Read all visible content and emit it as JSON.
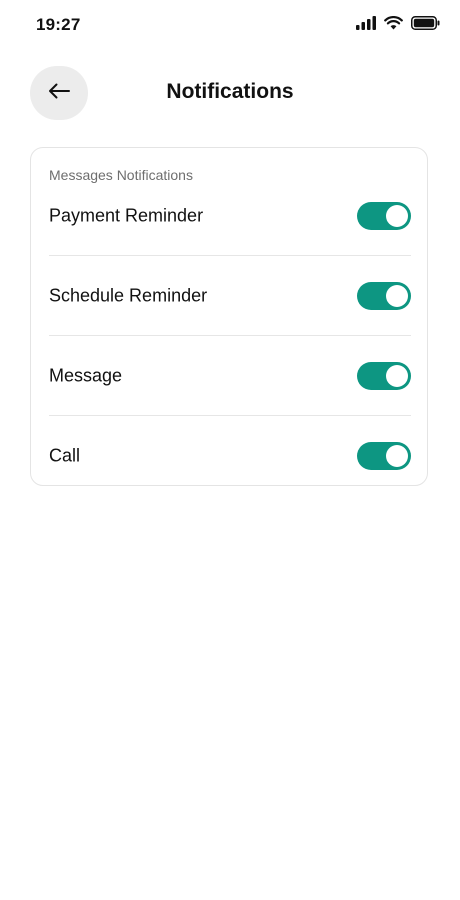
{
  "status_bar": {
    "time": "19:27",
    "icons": [
      "signal-icon",
      "wifi-icon",
      "battery-icon"
    ]
  },
  "header": {
    "back_icon": "arrow-left-icon",
    "title": "Notifications"
  },
  "settings": {
    "section_title": "Messages Notifications",
    "items": [
      {
        "label": "Payment Reminder",
        "enabled": true
      },
      {
        "label": "Schedule Reminder",
        "enabled": true
      },
      {
        "label": "Message",
        "enabled": true
      },
      {
        "label": "Call",
        "enabled": true
      }
    ]
  },
  "colors": {
    "toggle_on": "#0d9682",
    "back_button_bg": "#ececec",
    "card_border": "#e4e4e4"
  }
}
